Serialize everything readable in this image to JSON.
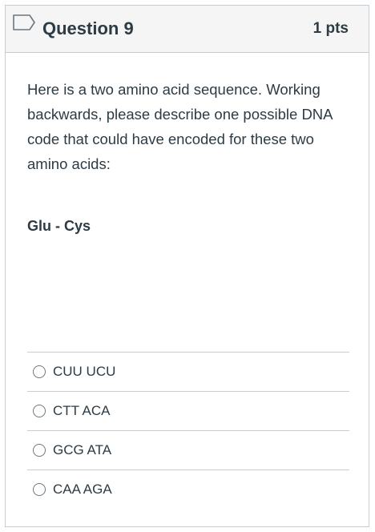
{
  "question": {
    "title": "Question 9",
    "points": "1 pts",
    "text": "Here is a two amino acid sequence. Working backwards, please describe one possible DNA code that could have encoded for these two amino acids:",
    "sequence": "Glu - Cys",
    "flag_icon": "bookmark-flag-outline",
    "answers": [
      {
        "label": "CUU UCU"
      },
      {
        "label": "CTT ACA"
      },
      {
        "label": "GCG ATA"
      },
      {
        "label": "CAA AGA"
      }
    ]
  },
  "colors": {
    "text": "#2d3b45",
    "border": "#c7cdd1",
    "header_bg": "#f5f5f5"
  }
}
